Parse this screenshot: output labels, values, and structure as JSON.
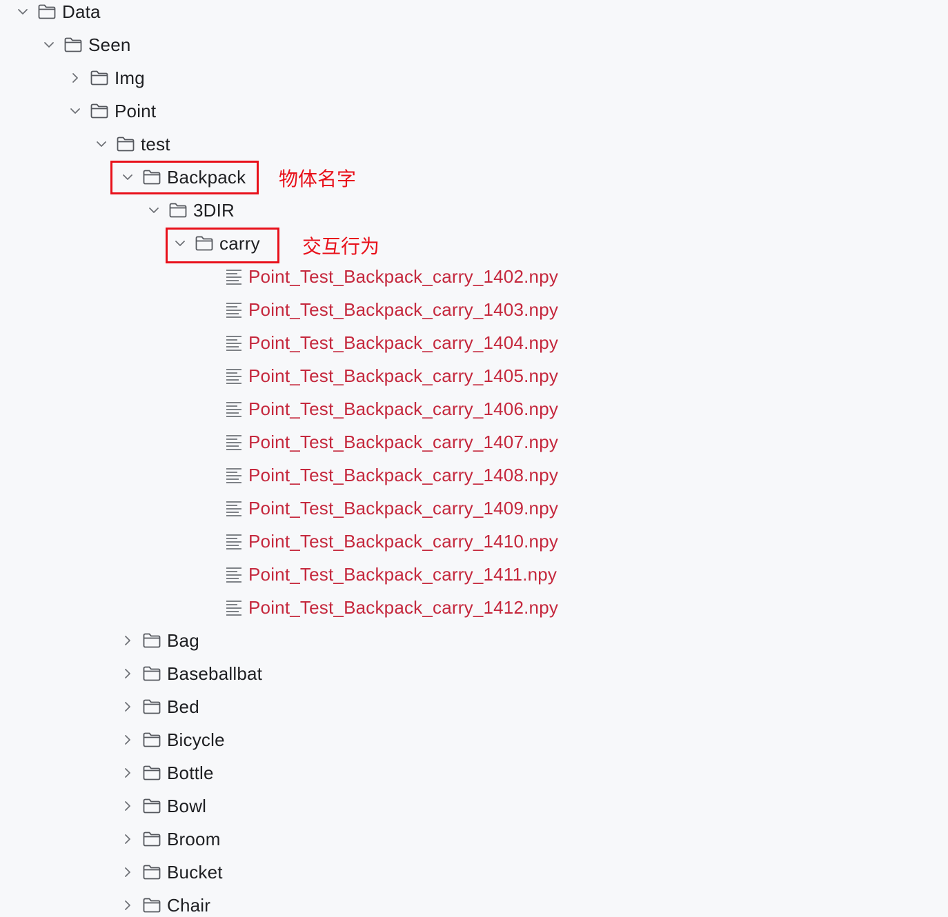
{
  "tree": {
    "data_folder": "Data",
    "seen_folder": "Seen",
    "img_folder": "Img",
    "point_folder": "Point",
    "test_folder": "test",
    "backpack_folder": "Backpack",
    "dir3_folder": "3DIR",
    "carry_folder": "carry",
    "files": [
      "Point_Test_Backpack_carry_1402.npy",
      "Point_Test_Backpack_carry_1403.npy",
      "Point_Test_Backpack_carry_1404.npy",
      "Point_Test_Backpack_carry_1405.npy",
      "Point_Test_Backpack_carry_1406.npy",
      "Point_Test_Backpack_carry_1407.npy",
      "Point_Test_Backpack_carry_1408.npy",
      "Point_Test_Backpack_carry_1409.npy",
      "Point_Test_Backpack_carry_1410.npy",
      "Point_Test_Backpack_carry_1411.npy",
      "Point_Test_Backpack_carry_1412.npy"
    ],
    "sibling_folders": [
      "Bag",
      "Baseballbat",
      "Bed",
      "Bicycle",
      "Bottle",
      "Bowl",
      "Broom",
      "Bucket",
      "Chair"
    ]
  },
  "annotations": {
    "object_name": "物体名字",
    "interaction": "交互行为"
  },
  "colors": {
    "file_text": "#c5283d",
    "highlight": "#e8101a",
    "background": "#f7f8fa"
  },
  "icons": {
    "expanded": "chevron-down-icon",
    "collapsed": "chevron-right-icon",
    "folder": "folder-icon",
    "file": "text-file-icon"
  }
}
